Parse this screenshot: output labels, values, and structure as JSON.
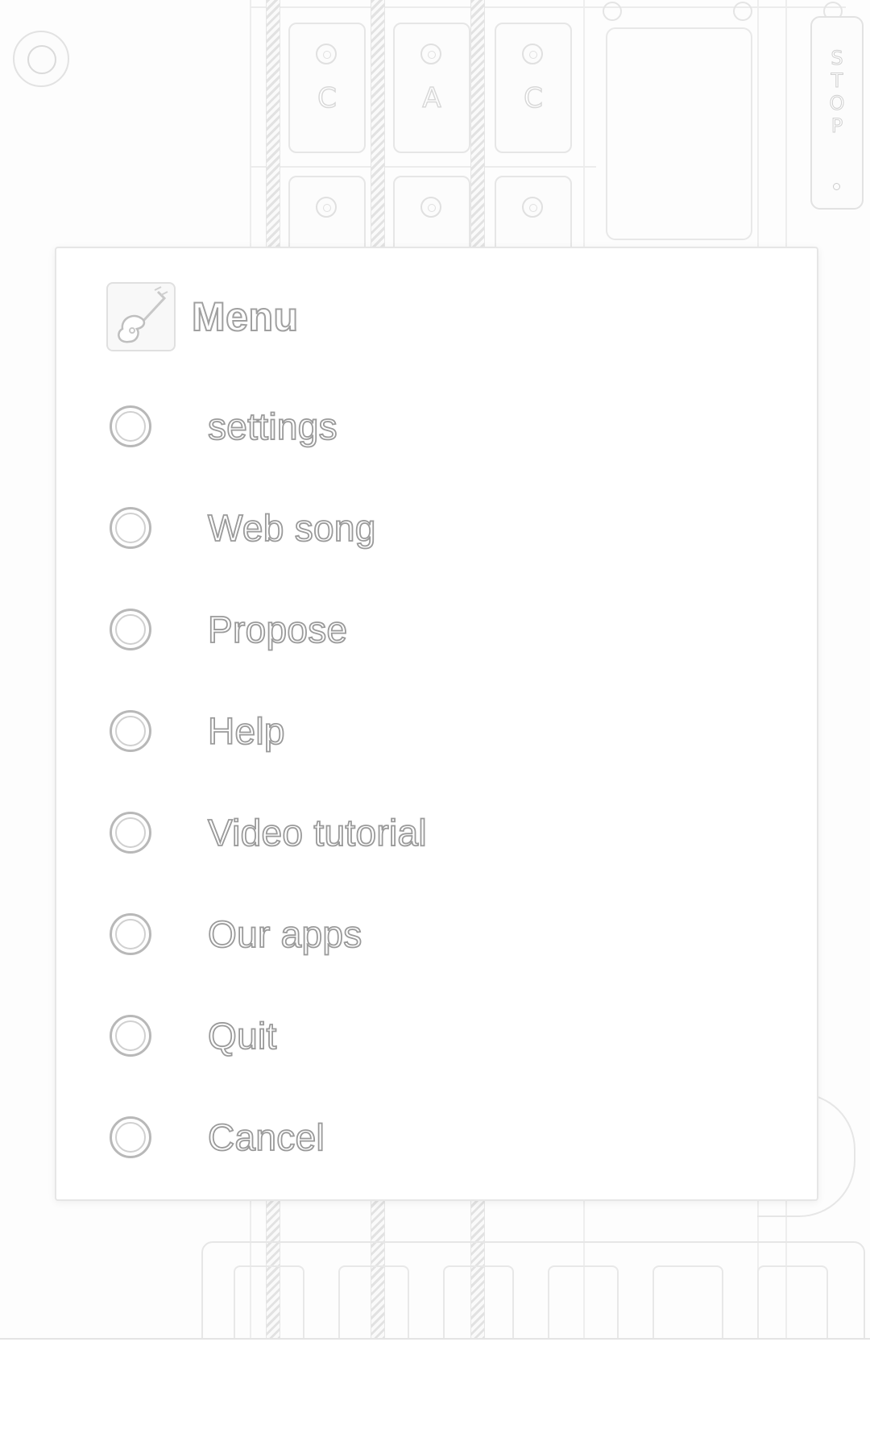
{
  "background": {
    "chord_keys_top": [
      "C",
      "A",
      "C"
    ],
    "chord_keys_row2": [
      "",
      "",
      ""
    ],
    "stop_label": "STOP"
  },
  "dialog": {
    "title": "Menu",
    "icon": "guitar-icon",
    "items": [
      {
        "label": "settings",
        "selected": false
      },
      {
        "label": "Web song",
        "selected": false
      },
      {
        "label": "Propose",
        "selected": false
      },
      {
        "label": "Help",
        "selected": false
      },
      {
        "label": "Video tutorial",
        "selected": false
      },
      {
        "label": "Our apps",
        "selected": false
      },
      {
        "label": "Quit",
        "selected": false
      },
      {
        "label": "Cancel",
        "selected": false
      }
    ]
  },
  "colors": {
    "outline": "#9a9a9a",
    "radio_border": "#b8b8b8",
    "background": "#ffffff"
  }
}
